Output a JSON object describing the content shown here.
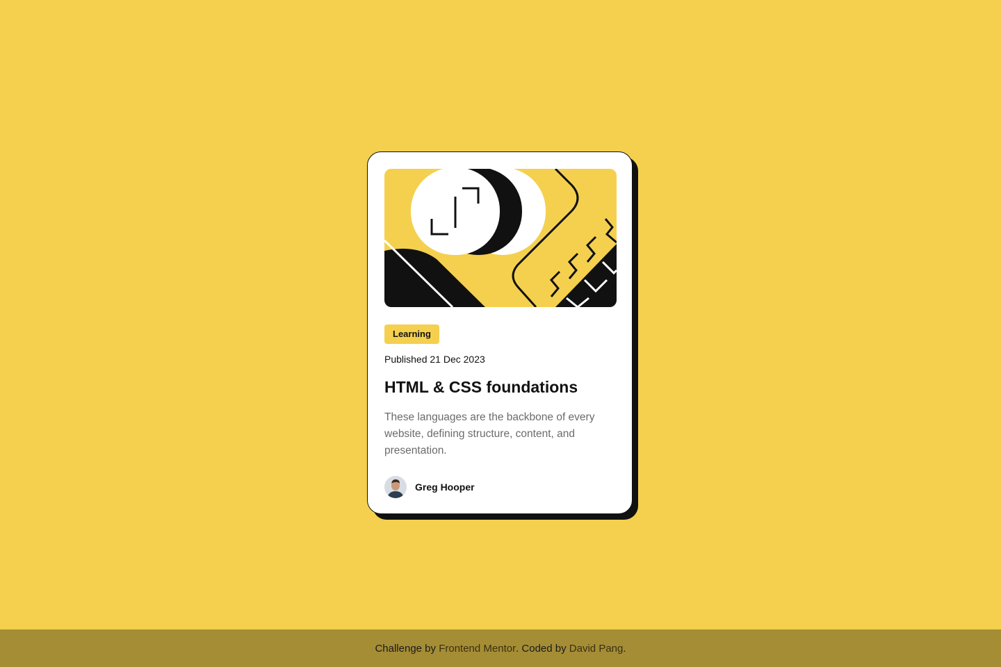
{
  "colors": {
    "background": "#f4d04e",
    "card": "#ffffff",
    "ink": "#111111",
    "muted_text": "#6b6b6b",
    "footer_bg": "#a58d35"
  },
  "card": {
    "hero_image": "abstract-illustration",
    "tag": "Learning",
    "published": "Published 21 Dec 2023",
    "title": "HTML & CSS foundations",
    "description": "These languages are the backbone of every website, defining structure, content, and presentation.",
    "author": {
      "avatar": "avatar-photo",
      "name": "Greg Hooper"
    }
  },
  "footer": {
    "prefix": "Challenge by",
    "link1": "Frontend Mentor",
    "middle": ". Coded by",
    "link2": "David Pang",
    "suffix": "."
  }
}
